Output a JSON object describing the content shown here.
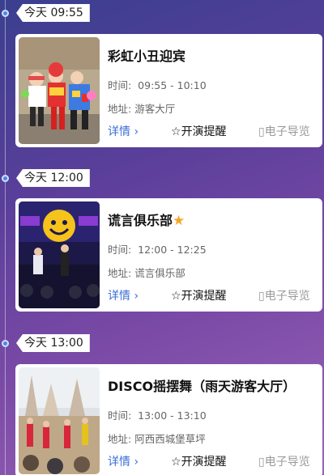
{
  "events": [
    {
      "time_tag": "今天 09:55",
      "title": "彩虹小丑迎宾",
      "has_star": false,
      "time_label": "时间:",
      "time_range": "09:55 - 10:10",
      "address_label": "地址:",
      "address": "游客大厅",
      "detail_label": "详情",
      "remind_label": "开演提醒",
      "guide_label": "电子导览"
    },
    {
      "time_tag": "今天 12:00",
      "title": "谎言俱乐部",
      "has_star": true,
      "time_label": "时间:",
      "time_range": "12:00 - 12:25",
      "address_label": "地址:",
      "address": "谎言俱乐部",
      "detail_label": "详情",
      "remind_label": "开演提醒",
      "guide_label": "电子导览"
    },
    {
      "time_tag": "今天 13:00",
      "title": "DISCO摇摆舞（雨天游客大厅）",
      "has_star": false,
      "time_label": "时间:",
      "time_range": "13:00 - 13:10",
      "address_label": "地址:",
      "address": "阿西西城堡草坪",
      "detail_label": "详情",
      "remind_label": "开演提醒",
      "guide_label": "电子导览"
    }
  ],
  "colors": {
    "accent": "#3a6fd6",
    "star": "#f5a623",
    "timeline_dot": "#4f86e8"
  }
}
